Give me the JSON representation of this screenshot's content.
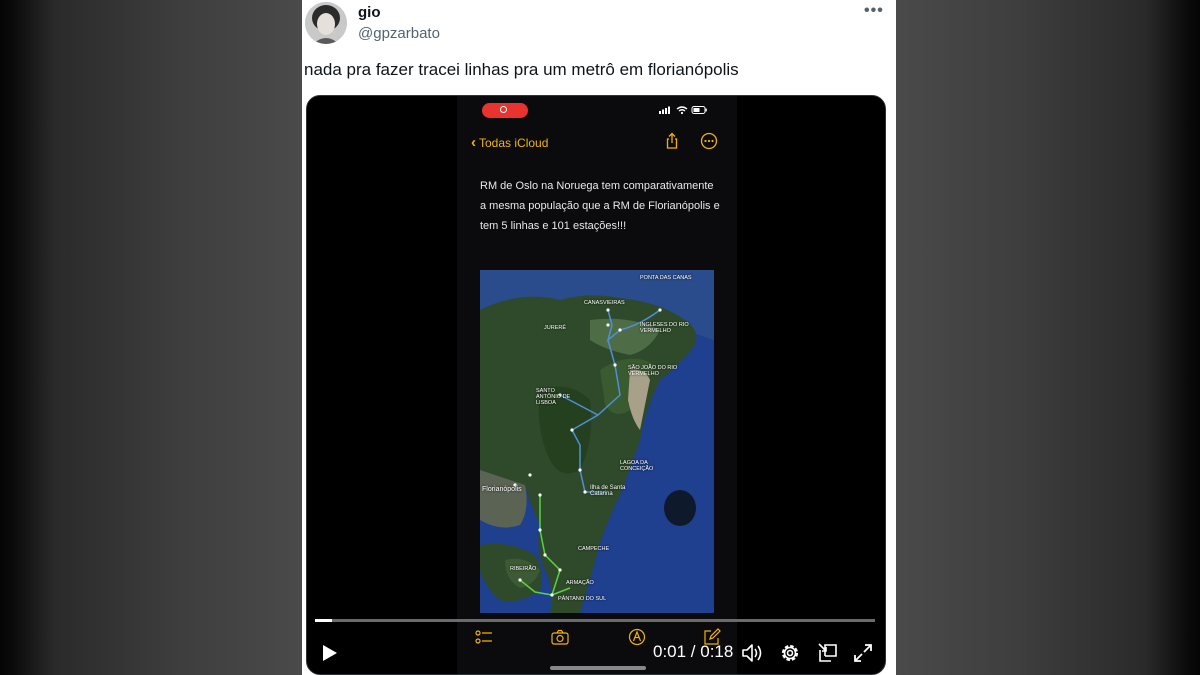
{
  "tweet": {
    "name": "gio",
    "handle": "@gpzarbato",
    "more_icon": "more-horizontal-icon",
    "text": "nada pra fazer tracei linhas pra um metrô em florianópolis"
  },
  "phone": {
    "back_label": "Todas iCloud",
    "note": "RM de Oslo na Noruega tem comparativamente a mesma população que a RM de Florianópolis e tem 5 linhas e 101 estações!!!",
    "map_labels": {
      "canasvieiras": "CANASVIEIRAS",
      "ingleses": "INGLESES DO RIO VERMELHO",
      "sao_joao": "SÃO JOÃO DO RIO VERMELHO",
      "santo_antonio": "SANTO ANTÔNIO DE LISBOA",
      "lagoa": "LAGOA DA CONCEIÇÃO",
      "florianopolis": "Florianópolis",
      "ilha": "Ilha de Santa Catarina",
      "campeche": "CAMPECHE",
      "jurere": "JURERÊ",
      "ponta": "PONTA DAS CANAS",
      "ribeirao": "RIBEIRÃO",
      "pantano": "PÂNTANO DO SUL",
      "armacao": "ARMAÇÃO"
    },
    "colors": {
      "accent": "#f4b400",
      "blue_line": "#4f8fd8",
      "green_line": "#5cd040"
    }
  },
  "video": {
    "time": "0:01 / 0:18",
    "progress": 0.03,
    "icons": [
      "play-icon",
      "volume-icon",
      "settings-icon",
      "pip-icon",
      "fullscreen-icon"
    ]
  }
}
